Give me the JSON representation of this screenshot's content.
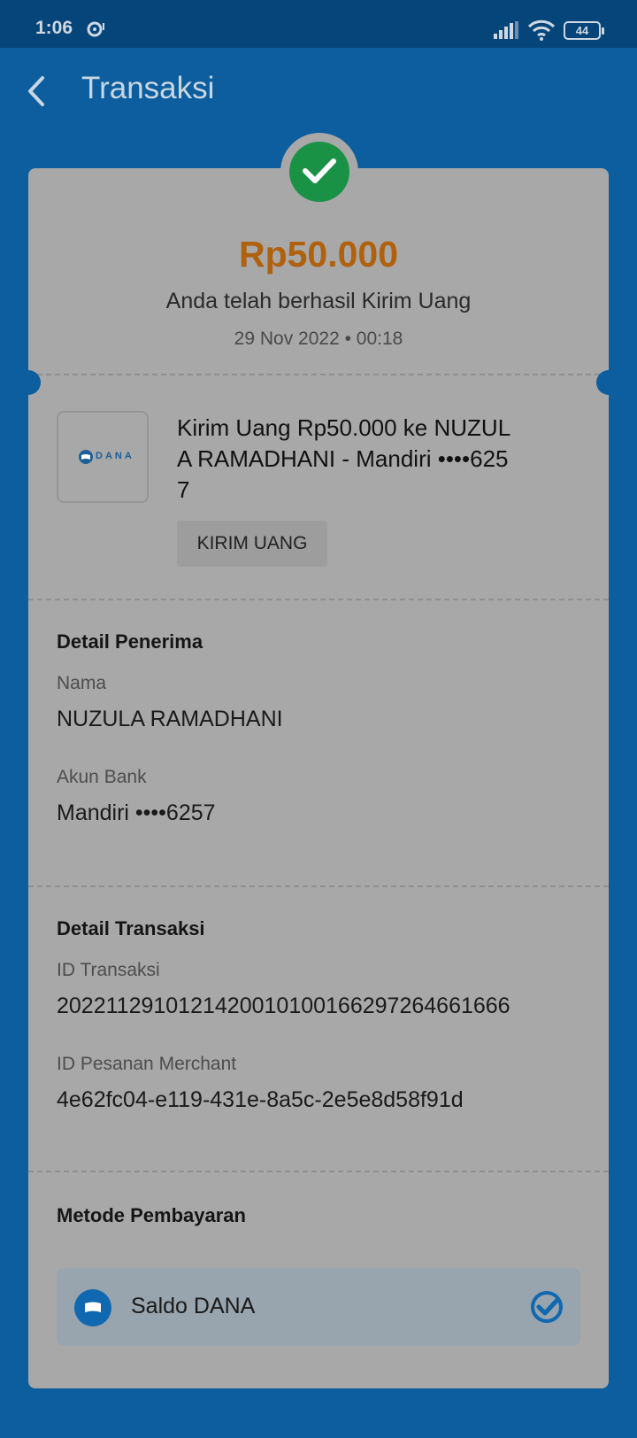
{
  "status_bar": {
    "time": "1:06",
    "battery": "44"
  },
  "header": {
    "title": "Transaksi"
  },
  "summary": {
    "amount": "Rp50.000",
    "message": "Anda telah berhasil Kirim Uang",
    "datetime": "29 Nov 2022 • 00:18"
  },
  "merchant": {
    "logo_text": "DANA",
    "title_line1": "Kirim Uang Rp50.000 ke NUZUL",
    "title_line2": "A RAMADHANI - Mandiri ••••625",
    "title_line3": "7",
    "category": "KIRIM UANG"
  },
  "recipient": {
    "section_title": "Detail Penerima",
    "name_label": "Nama",
    "name_value": "NUZULA RAMADHANI",
    "bank_label": "Akun Bank",
    "bank_value": "Mandiri ••••6257"
  },
  "transaction": {
    "section_title": "Detail Transaksi",
    "id_label": "ID Transaksi",
    "id_value": "2022112910121420010100166297264661666",
    "merchant_order_label": "ID Pesanan Merchant",
    "merchant_order_value": "4e62fc04-e119-431e-8a5c-2e5e8d58f91d"
  },
  "payment": {
    "section_title": "Metode Pembayaran",
    "method_label": "Saldo DANA"
  },
  "colors": {
    "background": "#0c5e9e",
    "amount": "#b0610d",
    "success": "#1a9246",
    "card": "#a8a8a8"
  },
  "icons": [
    "back-arrow-icon",
    "check-icon",
    "dana-logo-icon",
    "wallet-icon",
    "verified-check-icon",
    "signal-icon",
    "wifi-icon",
    "battery-icon"
  ]
}
